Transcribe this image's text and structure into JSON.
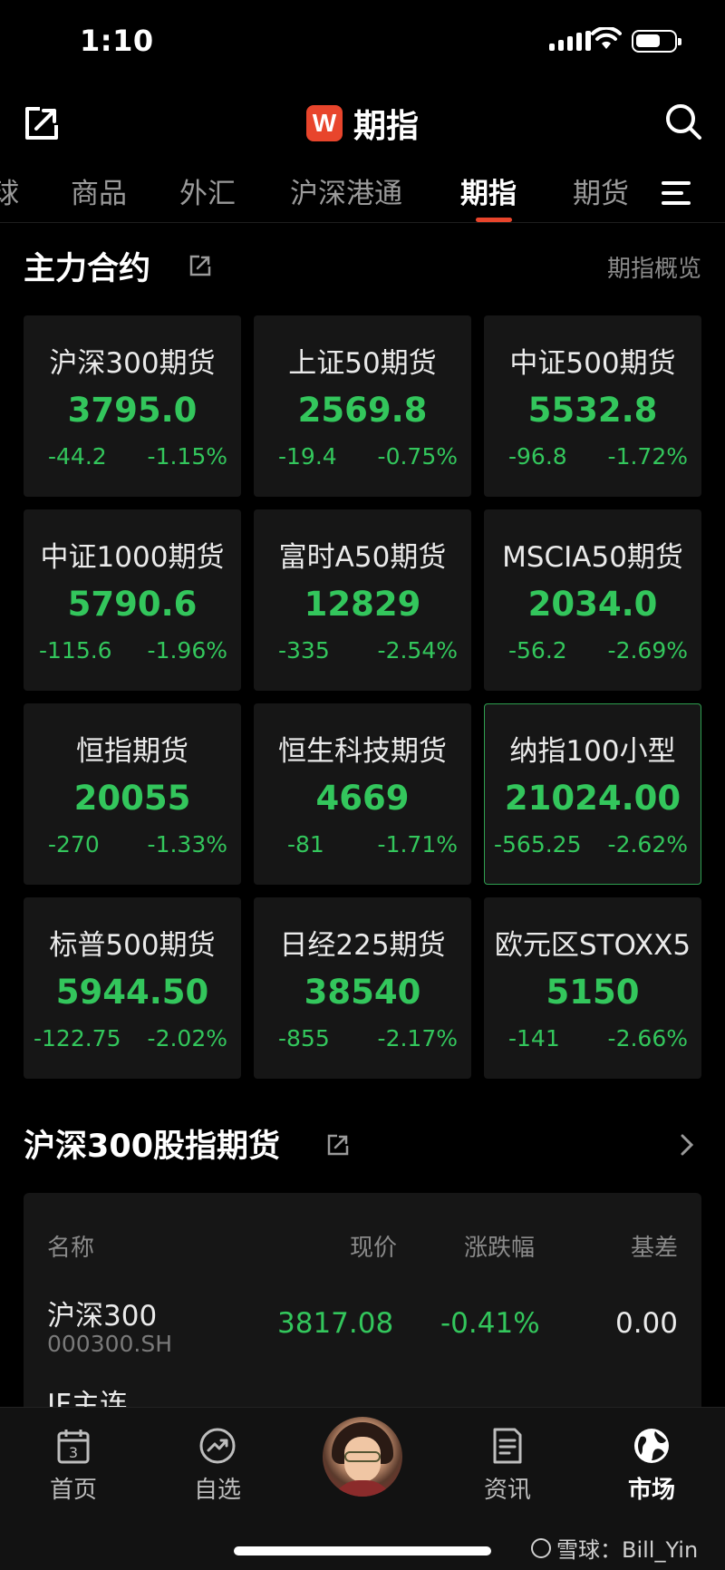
{
  "status_bar": {
    "time": "1:10"
  },
  "header": {
    "logo_letter": "W",
    "title": "期指"
  },
  "tabs": [
    {
      "label": "球"
    },
    {
      "label": "商品"
    },
    {
      "label": "外汇"
    },
    {
      "label": "沪深港通"
    },
    {
      "label": "期指",
      "active": true
    },
    {
      "label": "期货"
    }
  ],
  "main_contracts": {
    "title": "主力合约",
    "link": "期指概览",
    "cards": [
      {
        "name": "沪深300期货",
        "price": "3795.0",
        "change": "-44.2",
        "pct": "-1.15%"
      },
      {
        "name": "上证50期货",
        "price": "2569.8",
        "change": "-19.4",
        "pct": "-0.75%"
      },
      {
        "name": "中证500期货",
        "price": "5532.8",
        "change": "-96.8",
        "pct": "-1.72%"
      },
      {
        "name": "中证1000期货",
        "price": "5790.6",
        "change": "-115.6",
        "pct": "-1.96%"
      },
      {
        "name": "富时A50期货",
        "price": "12829",
        "change": "-335",
        "pct": "-2.54%"
      },
      {
        "name": "MSCIA50期货",
        "price": "2034.0",
        "change": "-56.2",
        "pct": "-2.69%"
      },
      {
        "name": "恒指期货",
        "price": "20055",
        "change": "-270",
        "pct": "-1.33%"
      },
      {
        "name": "恒生科技期货",
        "price": "4669",
        "change": "-81",
        "pct": "-1.71%"
      },
      {
        "name": "纳指100小型",
        "price": "21024.00",
        "change": "-565.25",
        "pct": "-2.62%",
        "selected": true
      },
      {
        "name": "标普500期货",
        "price": "5944.50",
        "change": "-122.75",
        "pct": "-2.02%"
      },
      {
        "name": "日经225期货",
        "price": "38540",
        "change": "-855",
        "pct": "-2.17%"
      },
      {
        "name": "欧元区STOXX5",
        "price": "5150",
        "change": "-141",
        "pct": "-2.66%"
      }
    ]
  },
  "hs300_section": {
    "title": "沪深300股指期货",
    "columns": {
      "name": "名称",
      "price": "现价",
      "change_pct": "涨跌幅",
      "basis": "基差"
    },
    "rows": [
      {
        "name": "沪深300",
        "code": "000300.SH",
        "price": "3817.08",
        "change_pct": "-0.41%",
        "basis": "0.00"
      },
      {
        "name": "IF主连"
      }
    ]
  },
  "bottom_nav": {
    "items": [
      {
        "label": "首页",
        "icon": "calendar-icon"
      },
      {
        "label": "自选",
        "icon": "trend-icon"
      },
      {
        "label": "资讯",
        "icon": "news-icon"
      },
      {
        "label": "市场",
        "icon": "globe-icon",
        "active": true
      }
    ]
  },
  "watermark": {
    "text": "雪球：Bill_Yin"
  },
  "colors": {
    "accent": "#e8452c",
    "down": "#33c65c",
    "background": "#000000",
    "card": "#161616"
  }
}
